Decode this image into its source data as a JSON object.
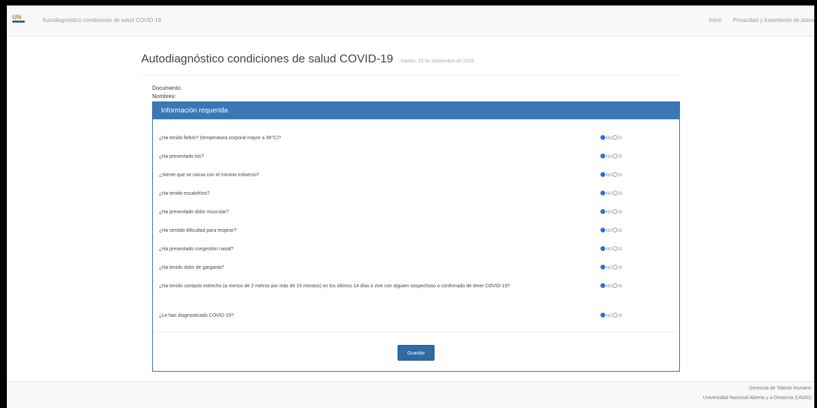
{
  "navbar": {
    "app_title": "Autodiagnóstico condiciones de salud COVID-19",
    "links": [
      "Inicio",
      "Privacidad y tratamiento de datos"
    ]
  },
  "header": {
    "title": "Autodiagnóstico condiciones de salud COVID-19",
    "date": "- martes, 29 de septiembre de 2020",
    "document_label": "Documento:",
    "names_label": "Nombres:"
  },
  "panel": {
    "heading": "Información requerida",
    "option_no": "NO",
    "option_si": "SI",
    "questions": [
      {
        "text": "¿Ha tenido fiebre? (temperatura corporal mayor a 38°C)?",
        "selected": "NO"
      },
      {
        "text": "¿Ha presentado tos?",
        "selected": "NO"
      },
      {
        "text": "¿Siente que se cansa con el mínimo esfuerzo?",
        "selected": "NO"
      },
      {
        "text": "¿Ha tenido escalofríos?",
        "selected": "NO"
      },
      {
        "text": "¿Ha presentado dolor muscular?",
        "selected": "NO"
      },
      {
        "text": "¿Ha sentido dificultad para respirar?",
        "selected": "NO"
      },
      {
        "text": "¿Ha presentado congestión nasal?",
        "selected": "NO"
      },
      {
        "text": "¿Ha tenido dolor de garganta?",
        "selected": "NO"
      },
      {
        "text": "¿Ha tenido contacto estrecho (a menos de 2 metros por más de 15 minutos) en los últimos 14 días o vive con alguien sospechoso o confirmado de tener COVID-19?",
        "selected": "NO"
      },
      {
        "text": "¿Le han diagnosticado COVID-19?",
        "selected": "NO"
      }
    ],
    "save_label": "Guardar"
  },
  "footer": {
    "line1": "Gerencia de Talento Humano",
    "line2": "Universidad Nacional Abierta y a Distancia (UNAD)"
  },
  "colors": {
    "accent": "#3a78b5",
    "radio_selected": "#2b6fd6"
  }
}
